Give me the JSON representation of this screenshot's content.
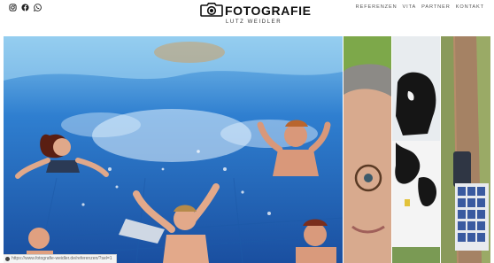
{
  "header": {
    "brand_title": "FOTOGRAFIE",
    "brand_subtitle": "LUTZ WEIDLER",
    "social_icons": [
      "instagram-icon",
      "facebook-icon",
      "whatsapp-icon"
    ],
    "nav": [
      {
        "label": "REFERENZEN"
      },
      {
        "label": "VITA"
      },
      {
        "label": "PARTNER"
      },
      {
        "label": "KONTAKT"
      }
    ]
  },
  "gallery": {
    "tiles": [
      {
        "subject": "underwater-swimming-pool-group"
      },
      {
        "subject": "man-with-glasses-portrait"
      },
      {
        "subject": "holstein-cows"
      },
      {
        "subject": "aerial-car-with-solar-panels"
      }
    ]
  },
  "status_bar": {
    "url": "https://www.fotografie-weidler.de/referenzen/?sel=1"
  },
  "colors": {
    "text": "#111111",
    "nav_text": "#555555",
    "water": "#2a6fc4"
  }
}
